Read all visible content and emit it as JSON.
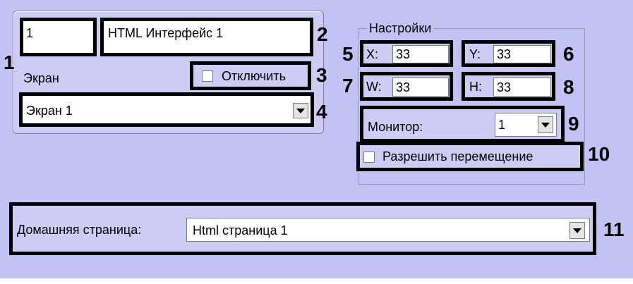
{
  "object": {
    "id_value": "1",
    "name_value": "HTML Интерфейс 1",
    "screen_label": "Экран",
    "disable_label": "Отключить",
    "screen_select_value": "Экран 1"
  },
  "settings": {
    "legend": "Настройки",
    "x_label": "X:",
    "x_value": "33",
    "y_label": "Y:",
    "y_value": "33",
    "w_label": "W:",
    "w_value": "33",
    "h_label": "H:",
    "h_value": "33",
    "monitor_label": "Монитор:",
    "monitor_value": "1",
    "allow_move_label": "Разрешить перемещение"
  },
  "home": {
    "label": "Домашняя страница:",
    "value": "Html страница 1"
  },
  "callouts": [
    "1",
    "2",
    "3",
    "4",
    "5",
    "6",
    "7",
    "8",
    "9",
    "10",
    "11"
  ]
}
